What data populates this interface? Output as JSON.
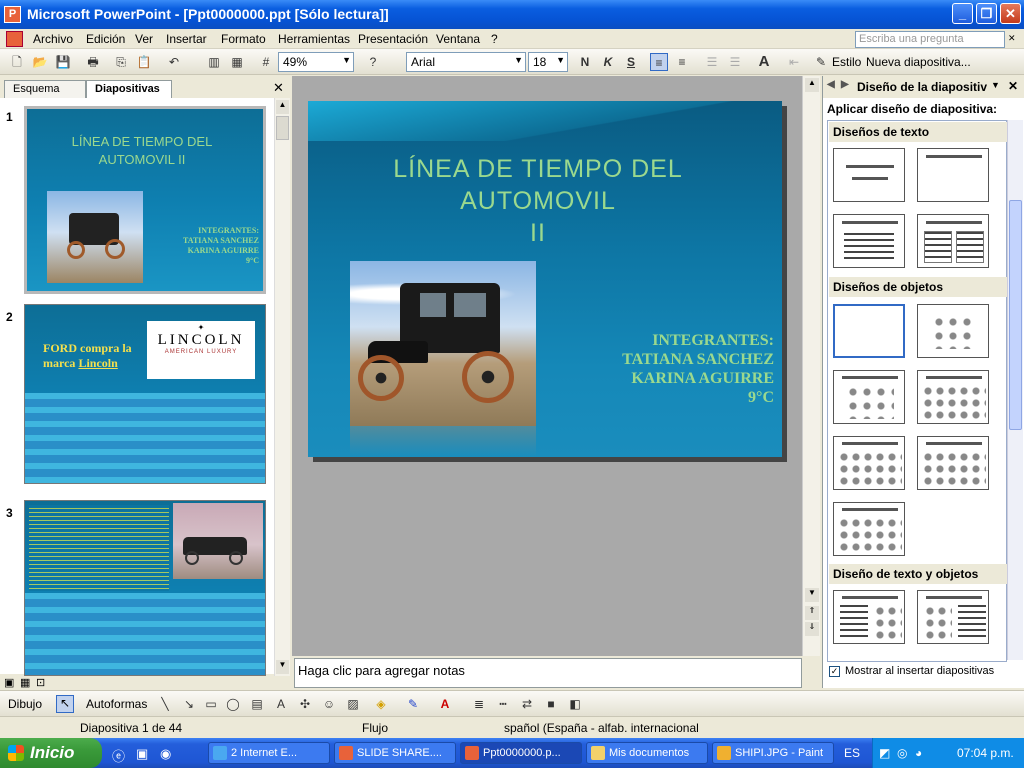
{
  "window": {
    "app_title": "Microsoft PowerPoint - [Ppt0000000.ppt [Sólo lectura]]",
    "controls": [
      "_",
      "❐",
      "✕"
    ]
  },
  "menu": {
    "items": [
      "Archivo",
      "Edición",
      "Ver",
      "Insertar",
      "Formato",
      "Herramientas",
      "Presentación",
      "Ventana",
      "?"
    ],
    "ask_placeholder": "Escriba una pregunta"
  },
  "toolbar": {
    "zoom": "49%",
    "font": "Arial",
    "font_size": "18",
    "bold": "N",
    "italic": "K",
    "underline": "S",
    "style_label": "Estilo",
    "new_slide_label": "Nueva diapositiva..."
  },
  "outline_tabs": [
    "Esquema",
    "Diapositivas"
  ],
  "thumbnails": [
    {
      "number": "1",
      "title": "LÍNEA DE TIEMPO DEL AUTOMOVIL II",
      "team": [
        "INTEGRANTES:",
        "TATIANA SANCHEZ",
        "KARINA AGUIRRE",
        "9°C"
      ]
    },
    {
      "number": "2",
      "title_text": "FORD compra la marca",
      "title_link": "Lincoln",
      "logo": "LINCOLN",
      "logo_sub": "AMERICAN LUXURY"
    },
    {
      "number": "3"
    }
  ],
  "slide": {
    "title_line1": "LÍNEA DE TIEMPO DEL",
    "title_line2": "AUTOMOVIL",
    "title_line3": "II",
    "team_heading": "INTEGRANTES:",
    "member1": "TATIANA SANCHEZ",
    "member2": "KARINA AGUIRRE",
    "grade": "9°C"
  },
  "notes_placeholder": "Haga clic para agregar notas",
  "task_pane": {
    "header": "Diseño de la diapositiv",
    "apply_label": "Aplicar diseño de diapositiva:",
    "sections": [
      "Diseños de texto",
      "Diseños de objetos",
      "Diseño de texto y objetos"
    ],
    "show_on_insert": "Mostrar al insertar diapositivas"
  },
  "drawing": {
    "dibujo": "Dibujo",
    "autoformas": "Autoformas"
  },
  "status": {
    "slide_pos": "Diapositiva 1 de 44",
    "design": "Flujo",
    "language": "spañol (España - alfab. internacional"
  },
  "taskbar": {
    "start": "Inicio",
    "tasks": [
      "2 Internet E...",
      "SLIDE SHARE....",
      "Ppt0000000.p...",
      "Mis documentos",
      "SHIPI.JPG - Paint"
    ],
    "lang": "ES",
    "clock": "07:04 p.m."
  },
  "colors": {
    "title_green": "#9bd98e",
    "slide_blue": "#0d75a3",
    "xp_blue": "#0653d4"
  }
}
